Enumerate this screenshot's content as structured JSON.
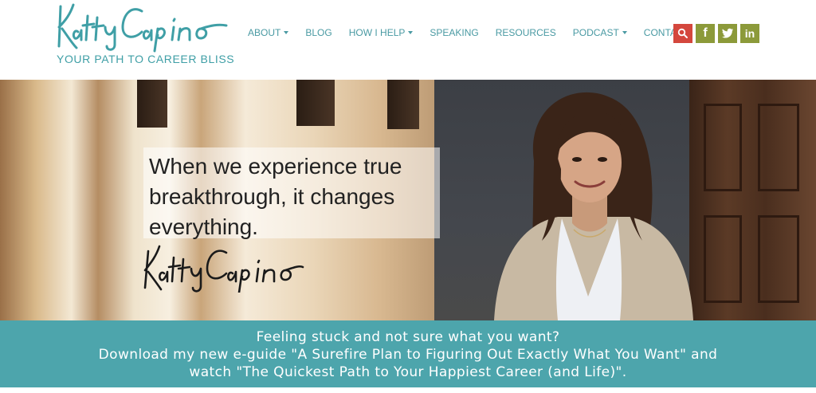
{
  "brand": {
    "logo_script": "Kathy Caprino",
    "tagline": "YOUR PATH TO CAREER BLISS"
  },
  "nav": {
    "items": [
      {
        "label": "ABOUT",
        "has_dropdown": true
      },
      {
        "label": "BLOG",
        "has_dropdown": false
      },
      {
        "label": "HOW I HELP",
        "has_dropdown": true
      },
      {
        "label": "SPEAKING",
        "has_dropdown": false
      },
      {
        "label": "RESOURCES",
        "has_dropdown": false
      },
      {
        "label": "PODCAST",
        "has_dropdown": true
      },
      {
        "label": "CONTACT",
        "has_dropdown": false
      }
    ]
  },
  "social": {
    "facebook_label": "f",
    "linkedin_label": "in"
  },
  "hero": {
    "quote_line1": "When we experience true",
    "quote_line2": "breakthrough, it changes",
    "quote_line3": "everything.",
    "signature": "Kathy Caprino"
  },
  "banner": {
    "line1": "Feeling stuck and not sure what you want?",
    "line2": "Download my new e-guide \"A Surefire Plan to Figuring Out Exactly What You Want\" and",
    "line3": "watch \"The Quickest Path to Your Happiest Career (and Life)\"."
  },
  "colors": {
    "accent_teal": "#4da5ac",
    "nav_text": "#4a9aa3",
    "search_red": "#d4473d",
    "social_olive": "#8c9a3a"
  }
}
